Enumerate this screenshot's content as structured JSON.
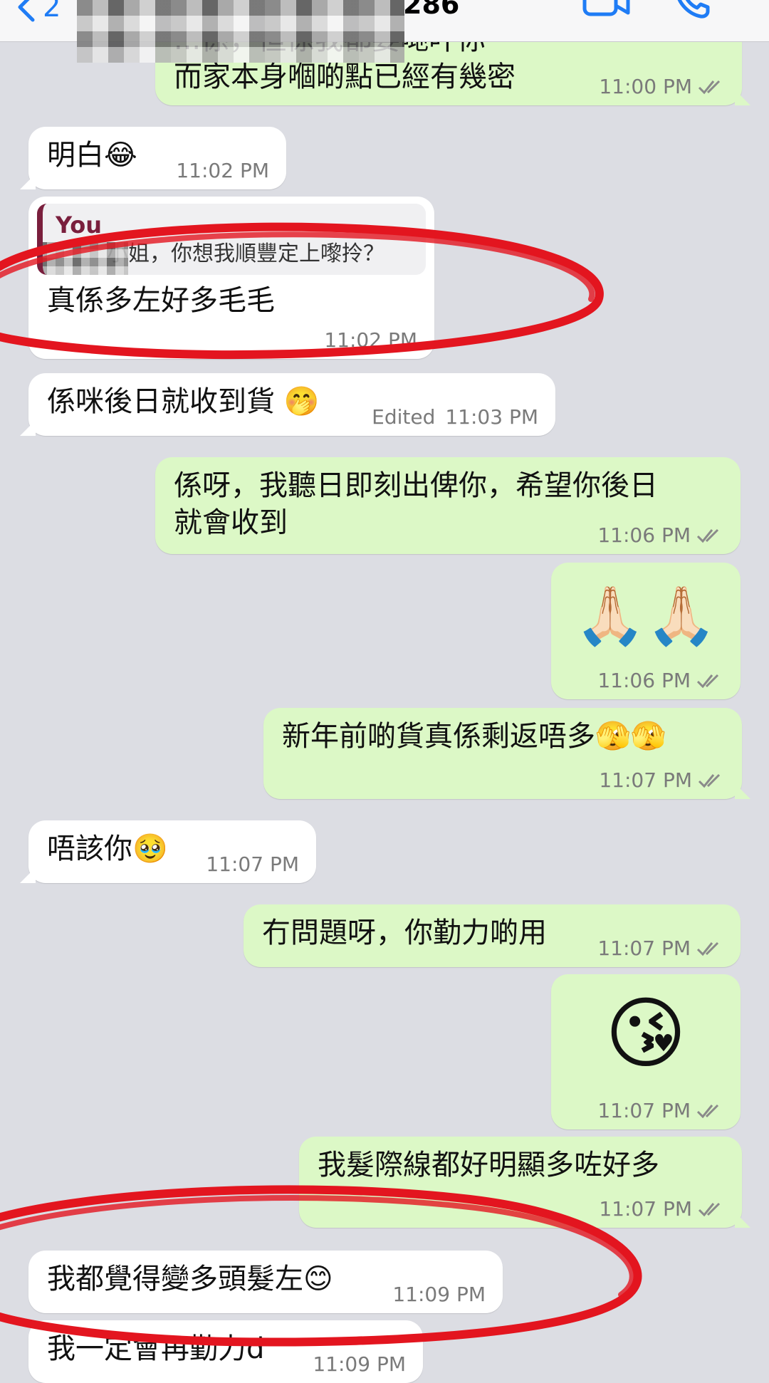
{
  "header": {
    "back_count": "2",
    "contact_name": "286",
    "accent": "#1f7cf5"
  },
  "messages": [
    {
      "id": "m1",
      "direction": "out",
      "text": "...係，但係我都要哋叶你\n而家本身嗰啲點已經有幾密",
      "time": "11:00 PM",
      "ticks": true
    },
    {
      "id": "m2",
      "direction": "in",
      "text": "明白😂",
      "time": "11:02 PM"
    },
    {
      "id": "m3",
      "direction": "in",
      "quote_author": "You",
      "quote_text": "小姐，你想我順豐定上嚟拎？",
      "text": "真係多左好多毛毛",
      "time": "11:02 PM"
    },
    {
      "id": "m4",
      "direction": "in",
      "text": "係咪後日就收到貨 🤭",
      "edited": "Edited",
      "time": "11:03 PM"
    },
    {
      "id": "m5",
      "direction": "out",
      "text": "係呀，我聽日即刻出俾你，希望你後日\n就會收到",
      "time": "11:06 PM",
      "ticks": true
    },
    {
      "id": "m6",
      "direction": "out",
      "text": "🙏🏻🙏🏻",
      "time": "11:06 PM",
      "ticks": true
    },
    {
      "id": "m7",
      "direction": "out",
      "text": "新年前啲貨真係剩返唔多🫣🫣",
      "time": "11:07 PM",
      "ticks": true
    },
    {
      "id": "m8",
      "direction": "in",
      "text": "唔該你🥹",
      "time": "11:07 PM"
    },
    {
      "id": "m9",
      "direction": "out",
      "text": "冇問題呀，你勤力啲用",
      "time": "11:07 PM",
      "ticks": true
    },
    {
      "id": "m10",
      "direction": "out",
      "text": "😘",
      "time": "11:07 PM",
      "ticks": true
    },
    {
      "id": "m11",
      "direction": "out",
      "text": "我髮際線都好明顯多咗好多",
      "time": "11:07 PM",
      "ticks": true
    },
    {
      "id": "m12",
      "direction": "in",
      "text": "我都覺得變多頭髮左😊",
      "time": "11:09 PM"
    },
    {
      "id": "m13",
      "direction": "in",
      "text": "我一定會再勤力d",
      "time": "11:09 PM"
    }
  ],
  "colors": {
    "background": "#dcdde3",
    "incoming_bubble": "#ffffff",
    "outgoing_bubble": "#dcf8c6",
    "read_ticks": "#8a8a8a",
    "annotation_red": "#e3151f",
    "quote_bar": "#7a1f3d"
  },
  "icons": [
    "chevron-left-icon",
    "video-camera-icon",
    "phone-icon",
    "double-check-icon"
  ]
}
